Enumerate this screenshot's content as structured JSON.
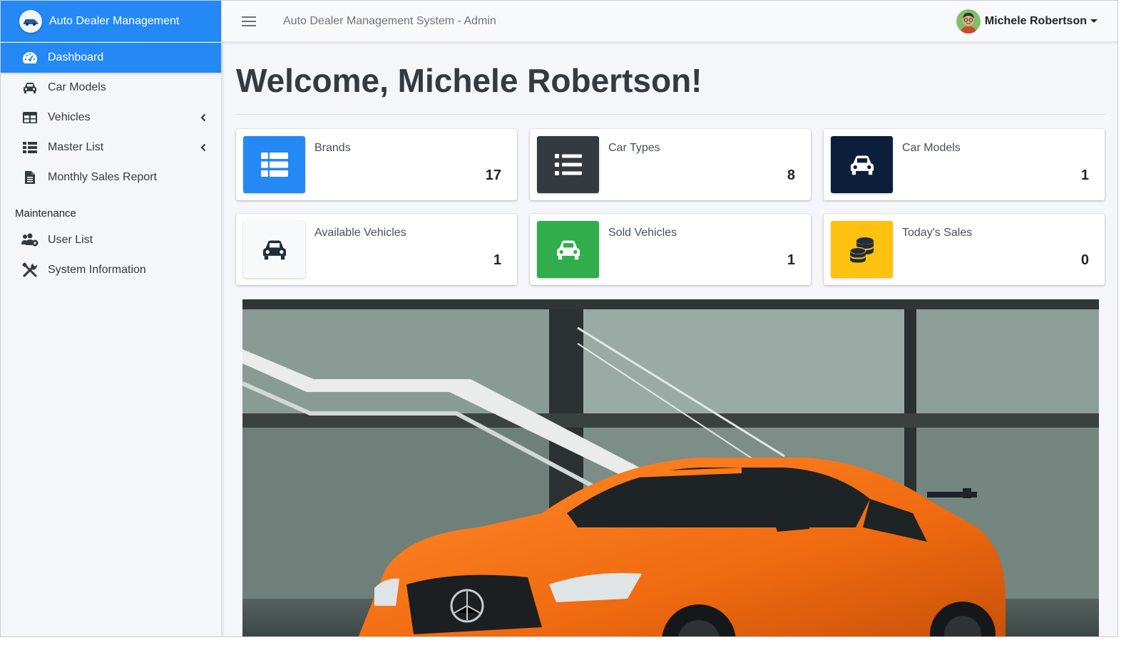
{
  "brand": {
    "name": "Auto Dealer Management",
    "logo_icon": "car-logo-icon"
  },
  "sidebar": {
    "items": [
      {
        "label": "Dashboard",
        "icon": "tachometer-icon",
        "active": true
      },
      {
        "label": "Car Models",
        "icon": "car-icon"
      },
      {
        "label": "Vehicles",
        "icon": "table-icon",
        "has_submenu": true
      },
      {
        "label": "Master List",
        "icon": "list-icon",
        "has_submenu": true
      },
      {
        "label": "Monthly Sales Report",
        "icon": "file-icon"
      }
    ],
    "section_header": "Maintenance",
    "maintenance_items": [
      {
        "label": "User List",
        "icon": "users-cog-icon"
      },
      {
        "label": "System Information",
        "icon": "tools-icon"
      }
    ]
  },
  "header": {
    "title": "Auto Dealer Management System - Admin",
    "user_name": "Michele Robertson"
  },
  "main": {
    "welcome": "Welcome, Michele Robertson!",
    "info_boxes": [
      {
        "label": "Brands",
        "value": "17",
        "icon": "th-list-icon",
        "color": "#2489f5"
      },
      {
        "label": "Car Types",
        "value": "8",
        "icon": "list-icon",
        "color": "#343a40"
      },
      {
        "label": "Car Models",
        "value": "1",
        "icon": "car-icon",
        "color": "#0c1f3a"
      },
      {
        "label": "Available Vehicles",
        "value": "1",
        "icon": "car-icon",
        "color": "#f8f9fa"
      },
      {
        "label": "Sold Vehicles",
        "value": "1",
        "icon": "car-icon",
        "color": "#32ad4c"
      },
      {
        "label": "Today's Sales",
        "value": "0",
        "icon": "coins-icon",
        "color": "#ffc10f"
      }
    ]
  },
  "colors": {
    "primary": "#2489f5",
    "sidebar_bg": "#f4f6f9",
    "content_bg": "#f4f6f9",
    "text_dark": "#343a40"
  }
}
